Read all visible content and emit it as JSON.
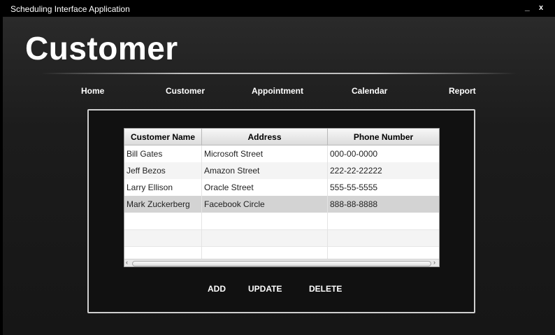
{
  "window": {
    "title": "Scheduling Interface Application",
    "minimize": "_",
    "close": "x"
  },
  "page": {
    "title": "Customer"
  },
  "nav": {
    "home": "Home",
    "customer": "Customer",
    "appointment": "Appointment",
    "calendar": "Calendar",
    "report": "Report"
  },
  "table": {
    "columns": [
      "Customer Name",
      "Address",
      "Phone Number"
    ],
    "rows": [
      [
        "Bill Gates",
        "Microsoft Street",
        "000-00-0000"
      ],
      [
        "Jeff Bezos",
        "Amazon Street",
        "222-22-22222"
      ],
      [
        "Larry Ellison",
        "Oracle Street",
        "555-55-5555"
      ],
      [
        "Mark Zuckerberg",
        "Facebook Circle",
        "888-88-8888"
      ]
    ],
    "selected_row": 3
  },
  "actions": {
    "add": "ADD",
    "update": "UPDATE",
    "delete": "DELETE"
  },
  "icons": {
    "scroll_left": "chevron-left-icon",
    "scroll_right": "chevron-right-icon"
  }
}
